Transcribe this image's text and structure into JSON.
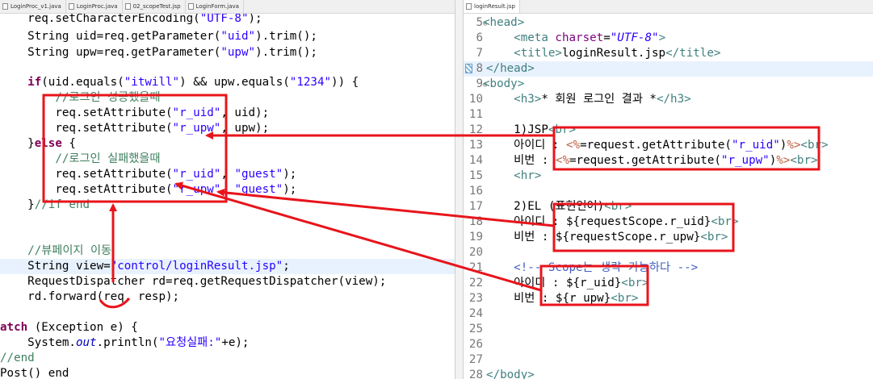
{
  "left_tabs": [
    "LoginProc_v1.java",
    "LoginProc.java",
    "02_scopeTest.jsp",
    "LoginForm.java"
  ],
  "right_tabs": [
    "loginResult.jsp"
  ],
  "left_code": {
    "l1": {
      "a": "    req.setCharacterEncoding(",
      "b": "\"UTF-8\"",
      "c": ");"
    },
    "l2": {
      "a": "    String uid=req.getParameter(",
      "b": "\"uid\"",
      "c": ").trim();"
    },
    "l3": {
      "a": "    String upw=req.getParameter(",
      "b": "\"upw\"",
      "c": ").trim();"
    },
    "l5": {
      "kw": "if",
      "a": "(uid.equals(",
      "b": "\"itwill\"",
      "c": ") && upw.equals(",
      "d": "\"1234\"",
      "e": ")) {"
    },
    "l6": {
      "cm": "//로그인 성공했을때"
    },
    "l7": {
      "a": "        req.setAttribute(",
      "b": "\"r_uid\"",
      "c": ", uid);"
    },
    "l8": {
      "a": "        req.setAttribute(",
      "b": "\"r_upw\"",
      "c": ", upw);"
    },
    "l9": {
      "a": "    }",
      "kw": "else",
      "c": " {"
    },
    "l10": {
      "cm": "//로그인 실패했을때"
    },
    "l11": {
      "a": "        req.setAttribute(",
      "b": "\"r_uid\"",
      "c": ", ",
      "d": "\"guest\"",
      "e": ");"
    },
    "l12": {
      "a": "        req.setAttribute(",
      "b": "\"r_upw\"",
      "c": ", ",
      "d": "\"guest\"",
      "e": ");"
    },
    "l13": {
      "a": "    }",
      "cm": "//if end"
    },
    "l16": {
      "cm": "//뷰페이지 이동"
    },
    "l17": {
      "a": "    String view=",
      "b": "\"control/loginResult.jsp\"",
      "c": ";"
    },
    "l18": {
      "a": "    RequestDispatcher rd=req.getRequestDispatcher(view);"
    },
    "l19": {
      "a": "    rd.forward(req, resp);"
    },
    "l21": {
      "kw": "atch",
      "a": " (Exception e) {"
    },
    "l22": {
      "a": "    System.",
      "f": "out",
      "b": ".println(",
      "c": "\"요청실패:\"",
      "d": "+e);"
    },
    "l23": {
      "cm": "//end"
    },
    "l24": {
      "a": "Post() end"
    }
  },
  "right_code": {
    "r5": {
      "n": "5",
      "a": "<head>"
    },
    "r6": {
      "n": "6",
      "a": "<meta ",
      "b": "charset",
      "c": "=",
      "d": "\"UTF-8\"",
      "e": ">"
    },
    "r7": {
      "n": "7",
      "a": "<title>",
      "b": "loginResult.jsp",
      "c": "</title>"
    },
    "r8": {
      "n": "8",
      "a": "</head>"
    },
    "r9": {
      "n": "9",
      "a": "<body>"
    },
    "r10": {
      "n": "10",
      "a": "<h3>",
      "b": "* 회원 로그인 결과 *",
      "c": "</h3>"
    },
    "r11": {
      "n": "11"
    },
    "r12": {
      "n": "12",
      "a": "1)JSP",
      "b": "<br>"
    },
    "r13": {
      "n": "13",
      "a": "아이디 : ",
      "b": "<%",
      "c": "=request.getAttribute(",
      "d": "\"r_uid\"",
      "e": ")",
      "f": "%>",
      "g": "<br>"
    },
    "r14": {
      "n": "14",
      "a": "비번 : ",
      "b": "<%",
      "c": "=request.getAttribute(",
      "d": "\"r_upw\"",
      "e": ")",
      "f": "%>",
      "g": "<br>"
    },
    "r15": {
      "n": "15",
      "a": "<hr>"
    },
    "r16": {
      "n": "16"
    },
    "r17": {
      "n": "17",
      "a": "2)EL (표현언어)",
      "b": "<br>"
    },
    "r18": {
      "n": "18",
      "a": "아이디 : ${requestScope.r_uid}",
      "b": "<br>"
    },
    "r19": {
      "n": "19",
      "a": "비번 : ${requestScope.r_upw}",
      "b": "<br>"
    },
    "r20": {
      "n": "20"
    },
    "r21": {
      "n": "21",
      "a": "<!-- Scope는 생략 가능하다 -->"
    },
    "r22": {
      "n": "22",
      "a": "아이디 : ${r_uid}",
      "b": "<br>"
    },
    "r23": {
      "n": "23",
      "a": "비번 : ${r_upw}",
      "b": "<br>"
    },
    "r24": {
      "n": "24"
    },
    "r25": {
      "n": "25"
    },
    "r26": {
      "n": "26"
    },
    "r27": {
      "n": "27"
    },
    "r28": {
      "n": "28",
      "a": "</body>"
    }
  },
  "annotation_color": "#e8141b"
}
